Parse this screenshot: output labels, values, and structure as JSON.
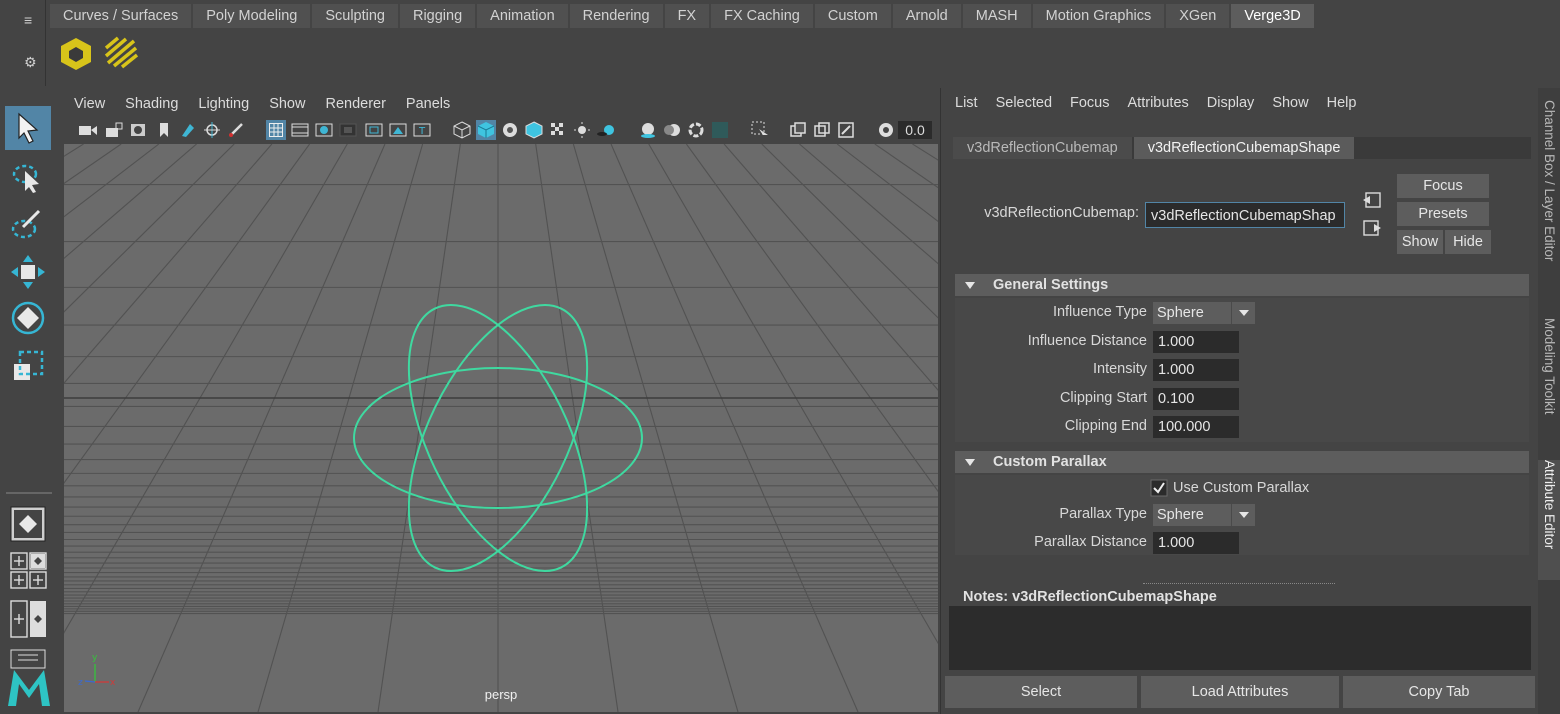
{
  "shelf": {
    "tabs": [
      "Curves / Surfaces",
      "Poly Modeling",
      "Sculpting",
      "Rigging",
      "Animation",
      "Rendering",
      "FX",
      "FX Caching",
      "Custom",
      "Arnold",
      "MASH",
      "Motion Graphics",
      "XGen",
      "Verge3D"
    ],
    "active_tab": "Verge3D",
    "icons": [
      "verge3d-cube-icon",
      "verge3d-stripes-icon"
    ]
  },
  "viewport": {
    "menu": [
      "View",
      "Shading",
      "Lighting",
      "Show",
      "Renderer",
      "Panels"
    ],
    "field_value": "0.0",
    "camera_label": "persp",
    "axis_labels": {
      "y": "y",
      "x": "x",
      "z": "z"
    },
    "object_color": "#3fd9a0"
  },
  "attribute_editor": {
    "menu": [
      "List",
      "Selected",
      "Focus",
      "Attributes",
      "Display",
      "Show",
      "Help"
    ],
    "tabs": [
      "v3dReflectionCubemap",
      "v3dReflectionCubemapShape"
    ],
    "active_tab": "v3dReflectionCubemapShape",
    "node_label": "v3dReflectionCubemap:",
    "node_value": "v3dReflectionCubemapShap",
    "buttons": {
      "focus": "Focus",
      "presets": "Presets",
      "show": "Show",
      "hide": "Hide"
    },
    "general": {
      "title": "General Settings",
      "influence_type_label": "Influence Type",
      "influence_type_value": "Sphere",
      "influence_distance_label": "Influence Distance",
      "influence_distance_value": "1.000",
      "intensity_label": "Intensity",
      "intensity_value": "1.000",
      "clip_start_label": "Clipping Start",
      "clip_start_value": "0.100",
      "clip_end_label": "Clipping End",
      "clip_end_value": "100.000"
    },
    "parallax": {
      "title": "Custom Parallax",
      "use_label": "Use Custom Parallax",
      "use_checked": true,
      "type_label": "Parallax Type",
      "type_value": "Sphere",
      "distance_label": "Parallax Distance",
      "distance_value": "1.000"
    },
    "notes_label": "Notes:  v3dReflectionCubemapShape",
    "bottom_buttons": [
      "Select",
      "Load Attributes",
      "Copy Tab"
    ]
  },
  "side_tabs": [
    "Channel Box / Layer Editor",
    "Modeling Toolkit",
    "Attribute Editor"
  ],
  "colors": {
    "accent": "#5285a6",
    "highlight_yellow": "#d8c41a",
    "maya_logo": "#2ec4c4"
  }
}
